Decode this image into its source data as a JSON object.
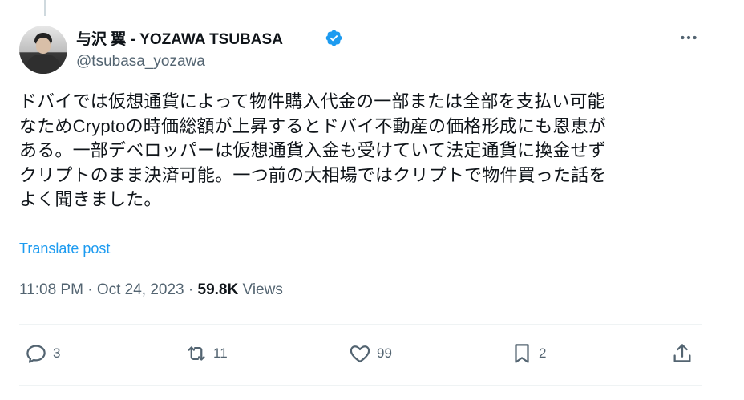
{
  "tweet": {
    "author_name": "与沢 翼 - YOZAWA TSUBASA",
    "handle": "@tsubasa_yozawa",
    "body": "ドバイでは仮想通貨によって物件購入代金の一部または全部を支払い可能\nなためCryptoの時価総額が上昇するとドバイ不動産の価格形成にも恩恵が\nある。一部デベロッパーは仮想通貨入金も受けていて法定通貨に換金せず\nクリプトのまま決済可能。一つ前の大相場ではクリプトで物件買った話を\nよく聞きました。",
    "translate_label": "Translate post",
    "time": "11:08 PM",
    "date": "Oct 24, 2023",
    "separator": "·",
    "views_count": "59.8K",
    "views_label": "Views"
  },
  "actions": {
    "replies": "3",
    "reposts": "11",
    "likes": "99",
    "bookmarks": "2"
  },
  "colors": {
    "accent": "#1d9bf0",
    "secondary_text": "#536471",
    "primary_text": "#0f1419"
  },
  "icons": [
    "verified-badge-icon",
    "more-icon",
    "reply-icon",
    "repost-icon",
    "like-icon",
    "bookmark-icon",
    "share-icon"
  ]
}
